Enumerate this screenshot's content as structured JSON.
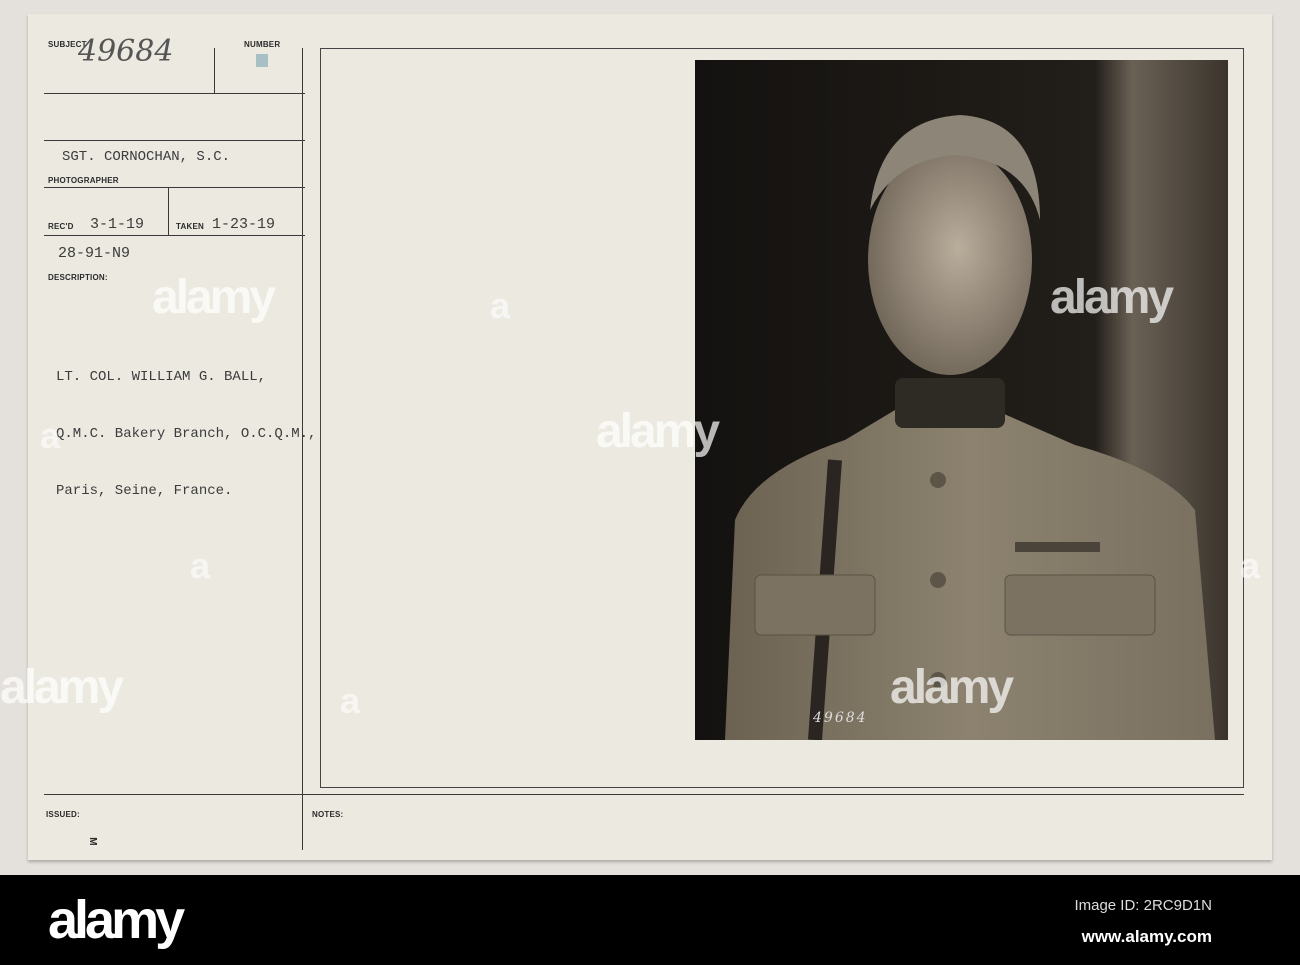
{
  "card": {
    "subject_label": "SUBJECT",
    "subject_handwritten": "49684",
    "number_label": "NUMBER",
    "photographer": "SGT. CORNOCHAN, S.C.",
    "photographer_label": "PHOTOGRAPHER",
    "recd_label": "REC'D",
    "recd_date": "3-1-19",
    "taken_label": "TAKEN",
    "taken_date": "1-23-19",
    "file_code": "28-91-N9",
    "description_label": "DESCRIPTION:",
    "description_lines": [
      "LT. COL. WILLIAM G. BALL,",
      "Q.M.C. Bakery Branch, O.C.Q.M.,",
      "Paris, Seine, France."
    ],
    "issued_label": "ISSUED:",
    "issued_mark": "M",
    "notes_label": "NOTES:",
    "photo_number": "49684"
  },
  "watermark": {
    "text": "alamy",
    "letter": "a"
  },
  "footer": {
    "logo": "alamy",
    "image_id": "Image ID: 2RC9D1N",
    "url": "www.alamy.com"
  }
}
